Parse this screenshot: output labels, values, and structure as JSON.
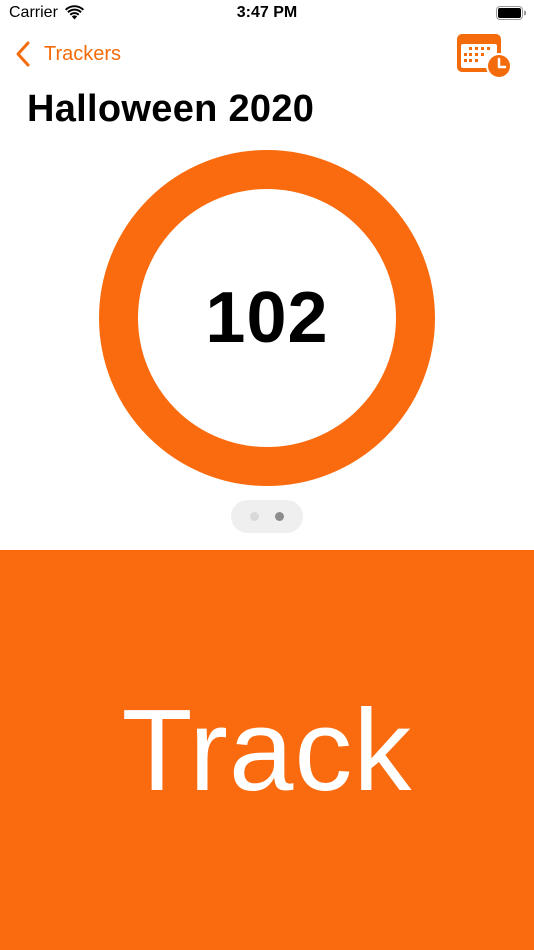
{
  "status_bar": {
    "carrier": "Carrier",
    "time": "3:47 PM",
    "icons": [
      "wifi-icon",
      "battery-icon"
    ]
  },
  "nav": {
    "back_label": "Trackers",
    "back_icon": "chevron-left-icon",
    "calendar_icon": "calendar-clock-icon"
  },
  "tracker": {
    "title": "Halloween 2020",
    "count": "102",
    "page_count": 2,
    "active_page": 2
  },
  "track_button": {
    "label": "Track"
  },
  "colors": {
    "accent": "#f96b0e",
    "text": "#000000",
    "button_text": "#ffffff",
    "page_indicator_bg": "#efefef"
  }
}
